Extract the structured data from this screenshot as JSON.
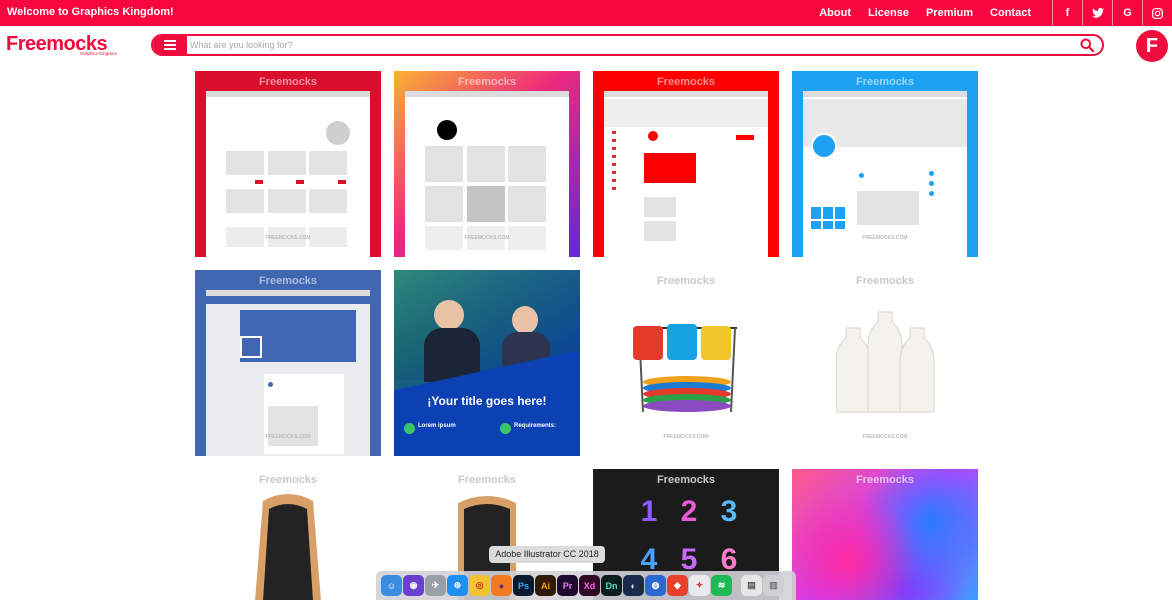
{
  "topbar": {
    "welcome": "Welcome to Graphics Kingdom!",
    "nav": [
      "About",
      "License",
      "Premium",
      "Contact"
    ],
    "social_icons": [
      "facebook-icon",
      "twitter-icon",
      "google-icon",
      "instagram-icon"
    ],
    "social_glyphs": [
      "f",
      "t",
      "G",
      "◎"
    ]
  },
  "header": {
    "logo": "Freemocks",
    "logo_sub": "Graphics Kingdom",
    "search_placeholder": "What are you looking for?",
    "avatar_letter": "F"
  },
  "tiles": [
    {
      "watermark": "Freemocks",
      "footer": "FREEMOCKS.COM"
    },
    {
      "watermark": "Freemocks",
      "footer": "FREEMOCKS.COM"
    },
    {
      "watermark": "Freemocks",
      "footer": ""
    },
    {
      "watermark": "Freemocks",
      "footer": "FREEMOCKS.COM"
    },
    {
      "watermark": "Freemocks",
      "footer": "FREEMOCKS.COM"
    },
    {
      "watermark": "",
      "footer": "",
      "headline": "¡Your title goes here!",
      "left_title": "Lorem ipsum",
      "right_title": "Requirements:"
    },
    {
      "watermark": "Freemocks",
      "footer": "FREEMOCKS.COM"
    },
    {
      "watermark": "Freemocks",
      "footer": "FREEMOCKS.COM"
    },
    {
      "watermark": "Freemocks",
      "footer": ""
    },
    {
      "watermark": "Freemocks",
      "footer": ""
    },
    {
      "watermark": "Freemocks",
      "footer": "",
      "numbers": [
        "1",
        "2",
        "3",
        "4",
        "5",
        "6"
      ]
    },
    {
      "watermark": "Freemocks",
      "footer": ""
    }
  ],
  "dock": {
    "tooltip": "Adobe Illustrator CC 2018",
    "apps": [
      {
        "name": "finder",
        "label": "☺",
        "bg": "#3b8de0",
        "fg": "#ffffff"
      },
      {
        "name": "siri",
        "label": "◉",
        "bg": "#6a3fd1",
        "fg": "#ffffff"
      },
      {
        "name": "launchpad",
        "label": "✈",
        "bg": "#9aa0a8",
        "fg": "#ffffff"
      },
      {
        "name": "safari",
        "label": "⊕",
        "bg": "#1e8ef0",
        "fg": "#ffffff"
      },
      {
        "name": "chrome",
        "label": "◎",
        "bg": "#f2c230",
        "fg": "#d4342a"
      },
      {
        "name": "firefox",
        "label": "●",
        "bg": "#f57a1f",
        "fg": "#4a2a8a"
      },
      {
        "name": "photoshop",
        "label": "Ps",
        "bg": "#0a1a2e",
        "fg": "#31a8ff"
      },
      {
        "name": "illustrator",
        "label": "Ai",
        "bg": "#2e1a05",
        "fg": "#ff9a00"
      },
      {
        "name": "premiere",
        "label": "Pr",
        "bg": "#1e0a2e",
        "fg": "#e67cff"
      },
      {
        "name": "xd",
        "label": "Xd",
        "bg": "#2e0a26",
        "fg": "#ff61f6"
      },
      {
        "name": "dimension",
        "label": "Dn",
        "bg": "#0a1e1e",
        "fg": "#52e0c8"
      },
      {
        "name": "cinema",
        "label": "◐",
        "bg": "#1a2a4a",
        "fg": "#ffffff"
      },
      {
        "name": "network",
        "label": "◍",
        "bg": "#2a6ad0",
        "fg": "#ffffff"
      },
      {
        "name": "sketchup",
        "label": "◆",
        "bg": "#e8402a",
        "fg": "#ffffff"
      },
      {
        "name": "keynote",
        "label": "✦",
        "bg": "#e9e9ee",
        "fg": "#d04040"
      },
      {
        "name": "spotify",
        "label": "≋",
        "bg": "#1db954",
        "fg": "#ffffff"
      },
      {
        "name": "preview",
        "label": "▤",
        "bg": "#e6e6e6",
        "fg": "#555555"
      },
      {
        "name": "trash",
        "label": "▥",
        "bg": "#d0d0d4",
        "fg": "#777777"
      }
    ]
  }
}
